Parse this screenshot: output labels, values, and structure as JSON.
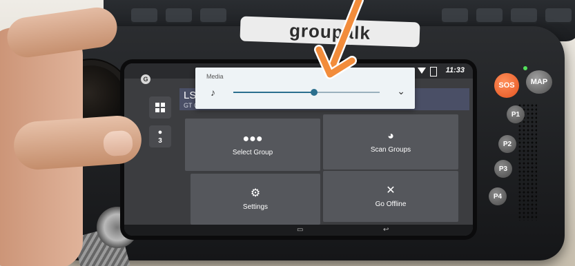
{
  "device": {
    "brand_text": "groupalk"
  },
  "status_bar": {
    "app_badge": "G",
    "time": "11:33"
  },
  "media_panel": {
    "label": "Media",
    "volume_fraction": 0.55
  },
  "group_header": {
    "title": "LS",
    "subtitle": "GT C"
  },
  "rail": {
    "member_count": "3"
  },
  "tiles": [
    {
      "label": "Select Group",
      "icon": "people-icon"
    },
    {
      "label": "Scan Groups",
      "icon": "headphones-icon"
    },
    {
      "label": "Settings",
      "icon": "gear-icon"
    },
    {
      "label": "Go Offline",
      "icon": "close-icon"
    }
  ],
  "hardware_buttons": {
    "sos": "SOS",
    "map": "MAP",
    "p1": "P1",
    "p2": "P2",
    "p3": "P3",
    "p4": "P4"
  },
  "colors": {
    "annotation_arrow": "#f28c3b",
    "sos": "#e4531f",
    "slider": "#2b6f8e"
  }
}
